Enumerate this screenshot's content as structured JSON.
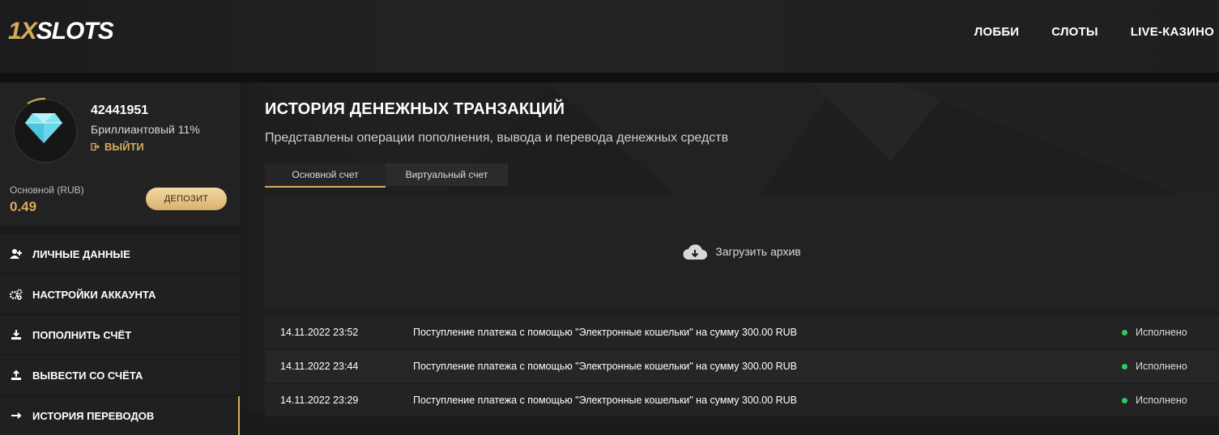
{
  "header": {
    "logo_prefix": "1X",
    "logo_suffix": "SLOTS",
    "nav": [
      "ЛОББИ",
      "СЛОТЫ",
      "LIVE-КАЗИНО"
    ]
  },
  "profile": {
    "user_id": "42441951",
    "level": "Бриллиантовый 11%",
    "logout": "ВЫЙТИ",
    "balance_label": "Основной (RUB)",
    "balance_value": "0.49",
    "deposit_button": "ДЕПОЗИТ"
  },
  "menu": [
    {
      "label": "ЛИЧНЫЕ ДАННЫЕ",
      "icon": "user-plus-icon"
    },
    {
      "label": "НАСТРОЙКИ АККАУНТА",
      "icon": "gears-icon"
    },
    {
      "label": "ПОПОЛНИТЬ СЧЁТ",
      "icon": "download-icon"
    },
    {
      "label": "ВЫВЕСТИ СО СЧЁТА",
      "icon": "upload-icon"
    },
    {
      "label": "ИСТОРИЯ ПЕРЕВОДОВ",
      "icon": "arrow-right-icon"
    }
  ],
  "main": {
    "title": "ИСТОРИЯ ДЕНЕЖНЫХ ТРАНЗАКЦИЙ",
    "subtitle": "Представлены операции пополнения, вывода и перевода денежных средств",
    "tabs": [
      "Основной счет",
      "Виртуальный счет"
    ],
    "archive_label": "Загрузить архив",
    "transactions": [
      {
        "date": "14.11.2022 23:52",
        "desc": "Поступление платежа с помощью \"Электронные кошельки\" на сумму 300.00 RUB",
        "status": "Исполнено"
      },
      {
        "date": "14.11.2022 23:44",
        "desc": "Поступление платежа с помощью \"Электронные кошельки\" на сумму 300.00 RUB",
        "status": "Исполнено"
      },
      {
        "date": "14.11.2022 23:29",
        "desc": "Поступление платежа с помощью \"Электронные кошельки\" на сумму 300.00 RUB",
        "status": "Исполнено"
      }
    ]
  },
  "colors": {
    "accent": "#d6ac5f",
    "status_ok": "#2ecc5a",
    "background": "#1b1b1b"
  }
}
